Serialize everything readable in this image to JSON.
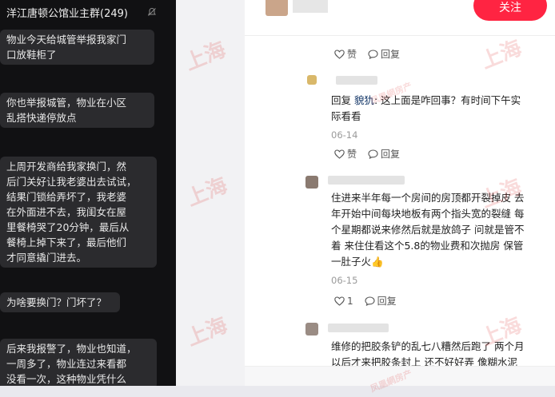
{
  "chat": {
    "title": "洋江唐顿公馆业主群(249)",
    "messages": [
      {
        "lines": [
          "物业今天给城管举报我家门",
          "口放鞋柜了"
        ]
      },
      {
        "lines": [
          "你也举报城管，物业在小区",
          "乱搭快递停放点"
        ]
      },
      {
        "lines": [
          "上周开发商给我家换门，然",
          "后门关好让我老婆出去试试，",
          "结果门锁给弄坏了，我老婆",
          "在外面进不去，我闺女在屋",
          "里餐椅哭了20分钟，最后从",
          "餐椅上掉下来了，最后他们",
          "才同意撬门进去。"
        ]
      },
      {
        "lines": [
          "为啥要换门？门坏了？"
        ]
      },
      {
        "lines": [
          "后来我报警了，物业也知道，",
          "一周多了，物业连过来看都",
          "没看一次，这种物业凭什么"
        ]
      }
    ]
  },
  "comments_panel": {
    "follow_label": "关注",
    "like_label": "赞",
    "reply_label": "回复",
    "reply1": {
      "prefix": "回复 ",
      "mention": "貌犰",
      "text_lines": [
        ": 这上面是咋回事？有时间下午实",
        "际看看"
      ],
      "date": "06-14"
    },
    "comment2": {
      "text_lines": [
        "住进来半年每一个房间的房顶都开裂掉皮 去",
        "年开始中间每块地板有两个指头宽的裂缝 每",
        "个星期都说来修然后就是放鸽子 问就是管不",
        "着 来住住看这个5.8的物业费和次抛房 保管",
        "一肚子火👍"
      ],
      "date": "06-15",
      "like_count": "1"
    },
    "comment3": {
      "text_lines": [
        "维修的把胶条铲的乱七八糟然后跑了 两个月",
        "以后才来把胶条封上 还不好好弄 像糊水泥"
      ]
    }
  },
  "watermark": {
    "text": "上海",
    "sub": "凤凰網房产",
    "color": "#dc1e1e"
  }
}
